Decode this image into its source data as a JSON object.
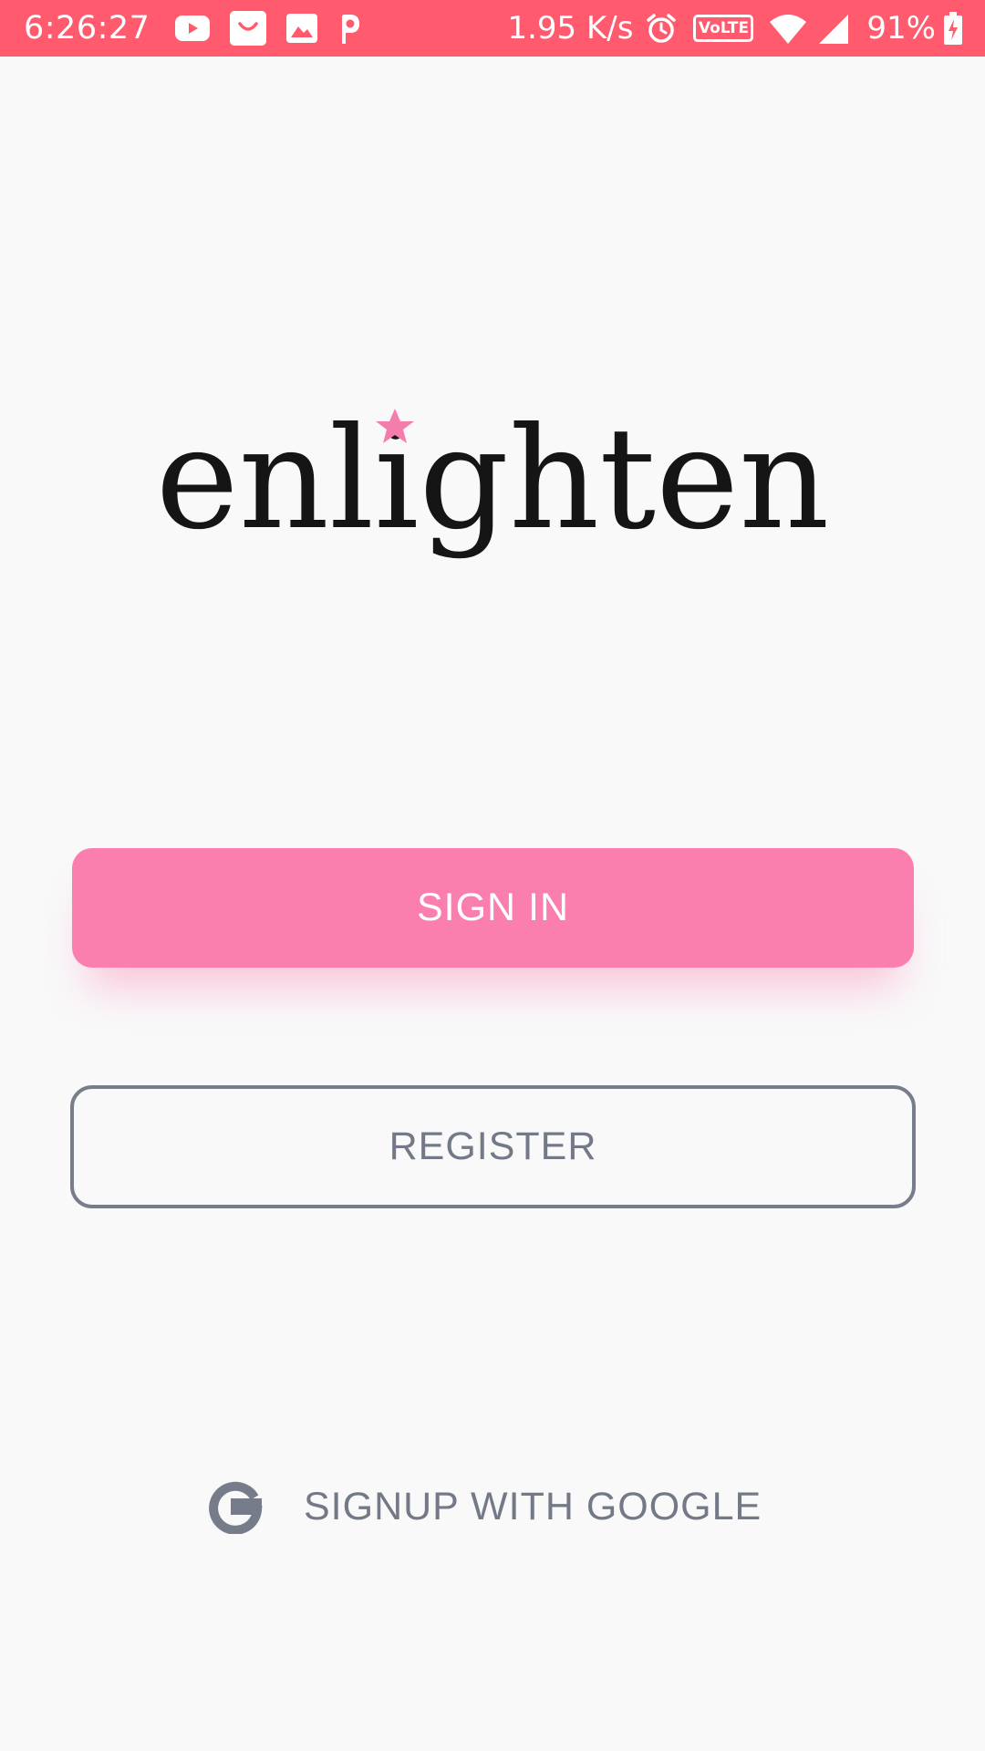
{
  "status_bar": {
    "time": "6:26:27",
    "network_speed": "1.95 K/s",
    "volte_label": "VoLTE",
    "battery_percent": "91%",
    "background_color": "#ff5a6e",
    "left_icons": [
      "youtube-icon",
      "shopping-bag-icon",
      "gallery-icon",
      "p-app-icon"
    ],
    "right_icons": [
      "alarm-icon",
      "volte-icon",
      "wifi-icon",
      "cellular-signal-icon",
      "battery-charging-icon"
    ]
  },
  "logo": {
    "text": "enlighten",
    "accent_color": "#f57dab",
    "accent_icon": "star-icon"
  },
  "buttons": {
    "sign_in": "SIGN IN",
    "register": "REGISTER",
    "google": "SIGNUP WITH GOOGLE"
  },
  "colors": {
    "primary": "#fb7fae",
    "outline": "#777d8a",
    "secondary_text": "#737987",
    "background": "#f9f9fa"
  }
}
